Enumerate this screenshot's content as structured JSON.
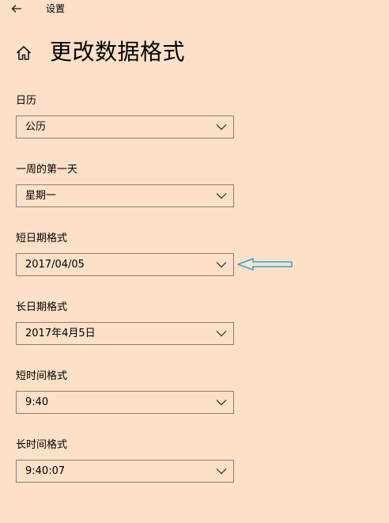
{
  "app": {
    "title": "设置",
    "back_icon": "arrow-left-icon"
  },
  "page": {
    "title": "更改数据格式",
    "home_icon": "home-icon"
  },
  "fields": [
    {
      "label": "日历",
      "value": "公历"
    },
    {
      "label": "一周的第一天",
      "value": "星期一"
    },
    {
      "label": "短日期格式",
      "value": "2017/04/05"
    },
    {
      "label": "长日期格式",
      "value": "2017年4月5日"
    },
    {
      "label": "短时间格式",
      "value": "9:40"
    },
    {
      "label": "长时间格式",
      "value": "9:40:07"
    }
  ],
  "annotation": {
    "icon": "callout-arrow-icon",
    "points_to": "短日期格式",
    "color": "#3aa0d8"
  },
  "colors": {
    "background": "#fde0c8",
    "border": "#8c7f74",
    "text": "#000000"
  }
}
